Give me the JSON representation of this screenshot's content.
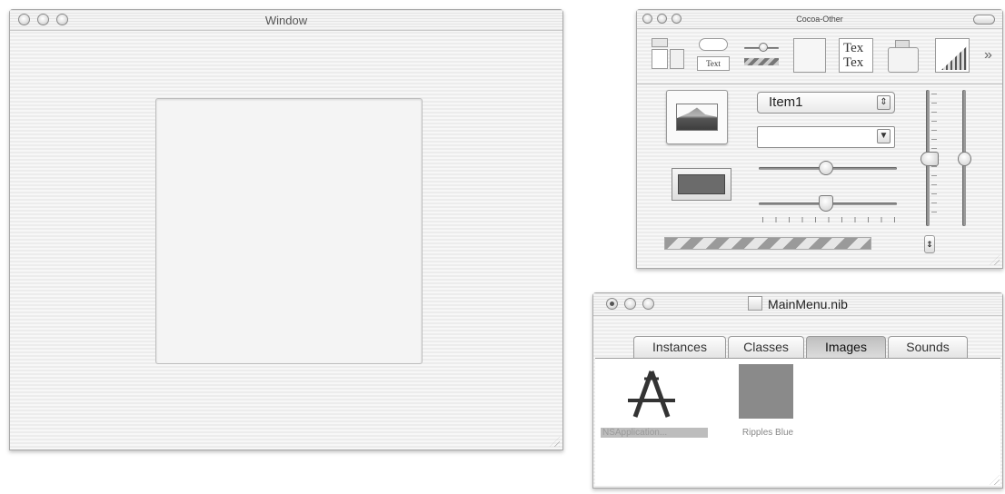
{
  "window1": {
    "title": "Window"
  },
  "palette": {
    "title": "Cocoa-Other",
    "toolbar": {
      "text_button_label": "Text",
      "text_field_line1": "Tex",
      "text_field_line2": "Tex",
      "more_glyph": "»"
    },
    "popup": {
      "selected": "Item1",
      "arrow": "⇕"
    },
    "combo_arrow": "▼",
    "stepper_glyph": "⇕"
  },
  "nib": {
    "title": "MainMenu.nib",
    "tabs": [
      {
        "label": "Instances"
      },
      {
        "label": "Classes"
      },
      {
        "label": "Images",
        "active": true
      },
      {
        "label": "Sounds"
      }
    ],
    "images": [
      {
        "label": "NSApplication..."
      },
      {
        "label": "Ripples Blue"
      }
    ]
  },
  "colors": {
    "ripples_swatch": "#8a8a8a",
    "color_well": "#6b6b6b",
    "selected_label_bg": "#bdbdbd"
  }
}
